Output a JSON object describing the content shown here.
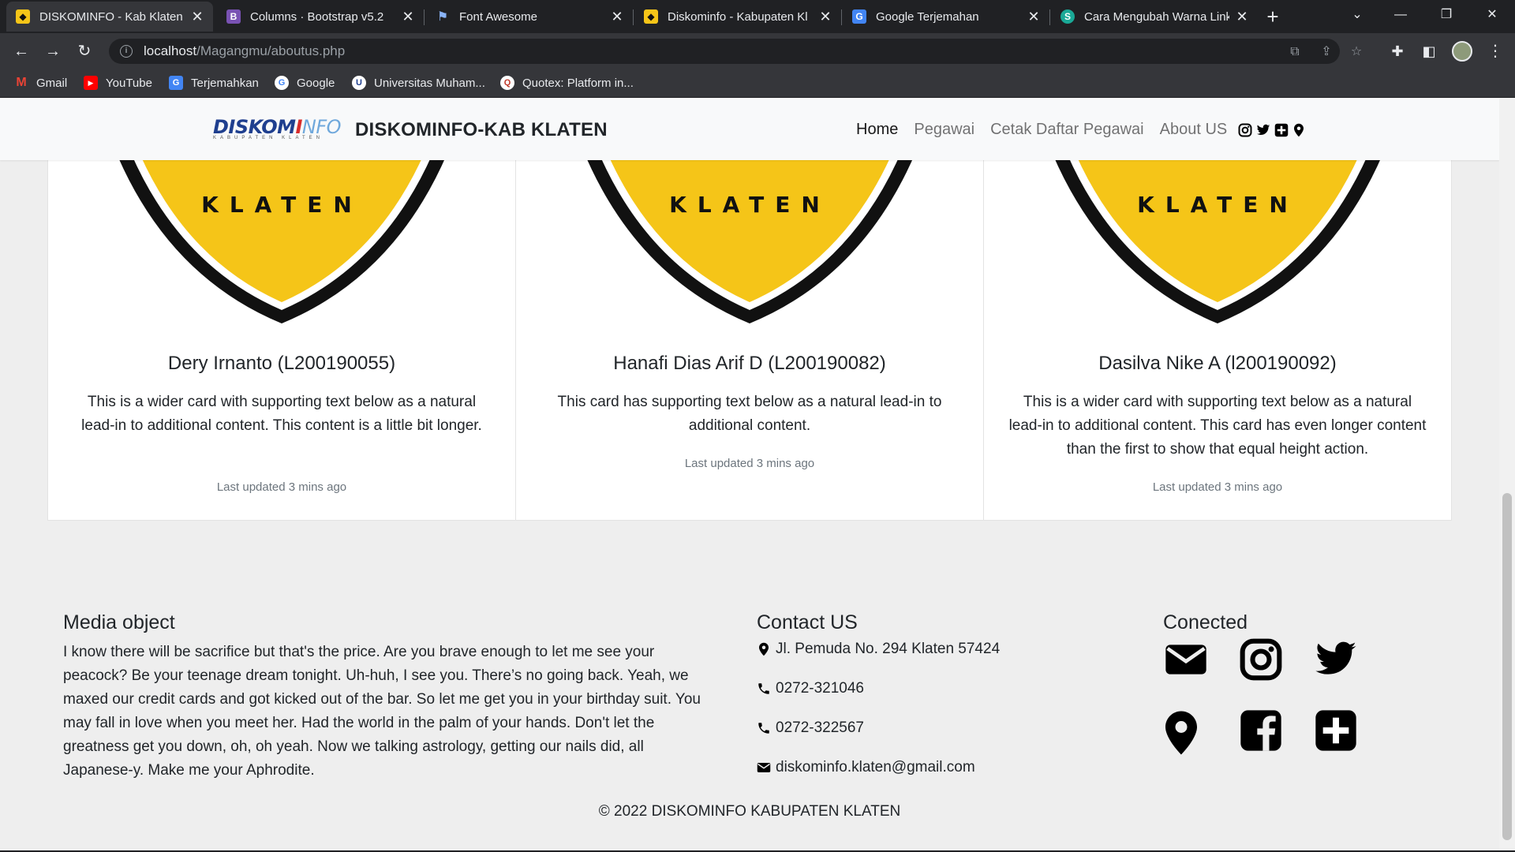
{
  "browser": {
    "tabs": [
      {
        "title": "DISKOMINFO - Kab Klaten",
        "icon": "klaten-emblem-icon",
        "active": true
      },
      {
        "title": "Columns · Bootstrap v5.2",
        "icon": "bootstrap-icon",
        "active": false
      },
      {
        "title": "Font Awesome",
        "icon": "font-awesome-flag-icon",
        "active": false
      },
      {
        "title": "Diskominfo - Kabupaten Kl",
        "icon": "klaten-emblem-icon",
        "active": false
      },
      {
        "title": "Google Terjemahan",
        "icon": "google-translate-icon",
        "active": false
      },
      {
        "title": "Cara Mengubah Warna Link",
        "icon": "s-logo-icon",
        "active": false
      }
    ],
    "url_host": "localhost",
    "url_path": "/Magangmu/aboutus.php",
    "bookmarks": [
      {
        "label": "Gmail",
        "icon": "gmail-icon"
      },
      {
        "label": "YouTube",
        "icon": "youtube-icon"
      },
      {
        "label": "Terjemahkan",
        "icon": "translate-icon"
      },
      {
        "label": "Google",
        "icon": "google-icon"
      },
      {
        "label": "Universitas Muham...",
        "icon": "university-icon"
      },
      {
        "label": "Quotex: Platform in...",
        "icon": "quotex-icon"
      }
    ]
  },
  "navbar": {
    "logo_text_a": "DISKOM",
    "logo_text_b": "I",
    "logo_text_c": "NFO",
    "logo_sub": "KABUPATEN KLATEN",
    "brand": "DISKOMINFO-KAB KLATEN",
    "links": [
      "Home",
      "Pegawai",
      "Cetak Daftar Pegawai",
      "About US"
    ],
    "active_link": "Home",
    "icons": [
      "instagram-icon",
      "twitter-icon",
      "plus-square-icon",
      "map-marker-icon"
    ]
  },
  "emblem_banner": "KLATEN",
  "cards": [
    {
      "title": "Dery Irnanto (L200190055)",
      "text": "This is a wider card with supporting text below as a natural lead-in to additional content. This content is a little bit longer.",
      "footer": "Last updated 3 mins ago"
    },
    {
      "title": "Hanafi Dias Arif D (L200190082)",
      "text": "This card has supporting text below as a natural lead-in to additional content.",
      "footer": "Last updated 3 mins ago"
    },
    {
      "title": "Dasilva Nike A (l200190092)",
      "text": "This is a wider card with supporting text below as a natural lead-in to additional content. This card has even longer content than the first to show that equal height action.",
      "footer": "Last updated 3 mins ago"
    }
  ],
  "footer": {
    "media_title": "Media object",
    "media_text": "I know there will be sacrifice but that's the price. Are you brave enough to let me see your peacock? Be your teenage dream tonight. Uh-huh, I see you. There’s no going back. Yeah, we maxed our credit cards and got kicked out of the bar. So let me get you in your birthday suit. You may fall in love when you meet her. Had the world in the palm of your hands. Don't let the greatness get you down, oh, oh yeah. Now we talking astrology, getting our nails did, all Japanese-y. Make me your Aphrodite.",
    "contact_title": "Contact US",
    "address": "Jl. Pemuda No. 294 Klaten 57424",
    "phone1": "0272-321046",
    "phone2": "0272-322567",
    "email": "diskominfo.klaten@gmail.com",
    "connected_title": "Conected",
    "social_icons": [
      "envelope-icon",
      "instagram-icon",
      "twitter-icon",
      "map-marker-icon",
      "facebook-icon",
      "plus-square-icon"
    ],
    "copyright": "© 2022 DISKOMINFO KABUPATEN KLATEN"
  },
  "colors": {
    "emblem_yellow": "#f5c518",
    "page_bg": "#eeeeee",
    "navbar_bg": "#f8f9fa",
    "chrome_dark": "#202124",
    "chrome_toolbar": "#35363a"
  }
}
